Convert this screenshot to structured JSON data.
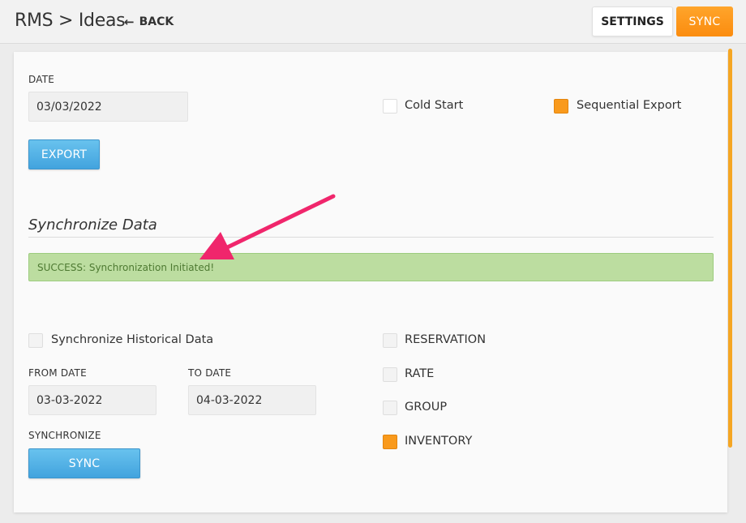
{
  "header": {
    "title": "RMS > Ideas",
    "back_label": "BACK",
    "settings_label": "SETTINGS",
    "sync_label": "SYNC"
  },
  "export": {
    "date_label": "DATE",
    "date_value": "03/03/2022",
    "cold_start_label": "Cold Start",
    "cold_start_checked": false,
    "sequential_export_label": "Sequential Export",
    "sequential_export_checked": true,
    "export_button": "EXPORT"
  },
  "sync": {
    "section_title": "Synchronize Data",
    "alert_text": "SUCCESS: Synchronization Initiated!",
    "historical_label": "Synchronize Historical Data",
    "historical_checked": false,
    "from_date_label": "FROM DATE",
    "from_date_value": "03-03-2022",
    "to_date_label": "TO DATE",
    "to_date_value": "04-03-2022",
    "synchronize_label": "SYNCHRONIZE",
    "sync_button": "SYNC",
    "options": [
      {
        "label": "RESERVATION",
        "checked": false
      },
      {
        "label": "RATE",
        "checked": false
      },
      {
        "label": "GROUP",
        "checked": false
      },
      {
        "label": "INVENTORY",
        "checked": true
      }
    ]
  },
  "colors": {
    "accent_orange": "#f99a1c",
    "button_blue": "#42a3de",
    "success_green": "#bcdda0",
    "annotation_pink": "#f0266c"
  },
  "icons": {
    "back": "arrow-left-icon"
  }
}
